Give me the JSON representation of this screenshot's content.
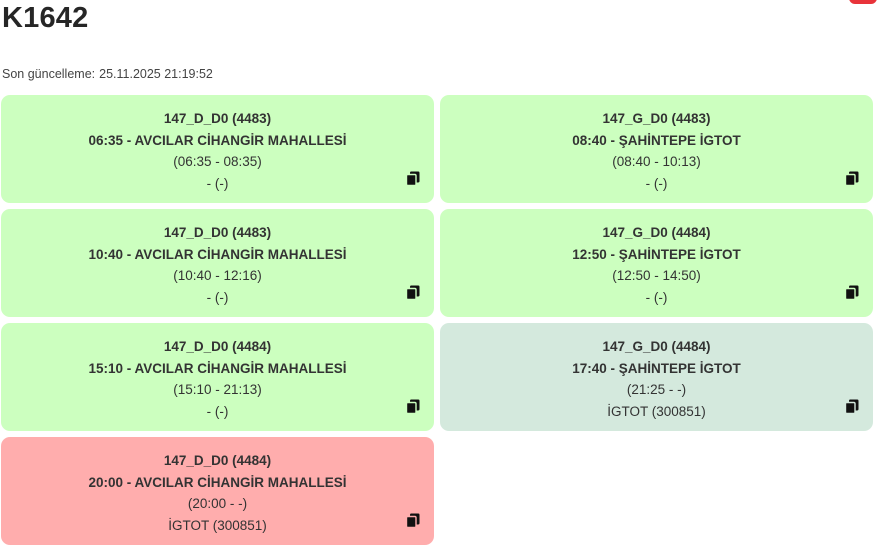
{
  "header": {
    "title": "K1642",
    "updated_label": "Son güncelleme:",
    "updated_value": "25.11.2025 21:19:52"
  },
  "colors": {
    "ok": "#ccffbf",
    "neutral": "#d4e9dd",
    "late": "#ffadad",
    "badge": "#e8333a"
  },
  "cards": [
    {
      "status": "ok",
      "route": "147_D_D0 (4483)",
      "trip": "06:35 - AVCILAR CİHANGİR MAHALLESİ",
      "time": "(06:35 - 08:35)",
      "note": "- (-)",
      "icon": "copy-icon"
    },
    {
      "status": "ok",
      "route": "147_G_D0 (4483)",
      "trip": "08:40 - ŞAHİNTEPE İGTOT",
      "time": "(08:40 - 10:13)",
      "note": "- (-)",
      "icon": "copy-icon"
    },
    {
      "status": "ok",
      "route": "147_D_D0 (4483)",
      "trip": "10:40 - AVCILAR CİHANGİR MAHALLESİ",
      "time": "(10:40 - 12:16)",
      "note": "- (-)",
      "icon": "copy-icon"
    },
    {
      "status": "ok",
      "route": "147_G_D0 (4484)",
      "trip": "12:50 - ŞAHİNTEPE İGTOT",
      "time": "(12:50 - 14:50)",
      "note": "- (-)",
      "icon": "copy-icon"
    },
    {
      "status": "ok",
      "route": "147_D_D0 (4484)",
      "trip": "15:10 - AVCILAR CİHANGİR MAHALLESİ",
      "time": "(15:10 - 21:13)",
      "note": "- (-)",
      "icon": "copy-icon"
    },
    {
      "status": "neutral",
      "route": "147_G_D0 (4484)",
      "trip": "17:40 - ŞAHİNTEPE İGTOT",
      "time": "(21:25 - -)",
      "note": "İGTOT (300851)",
      "icon": "copy-icon"
    },
    {
      "status": "late",
      "route": "147_D_D0 (4484)",
      "trip": "20:00 - AVCILAR CİHANGİR MAHALLESİ",
      "time": "(20:00 - -)",
      "note": "İGTOT (300851)",
      "icon": "copy-icon"
    }
  ]
}
